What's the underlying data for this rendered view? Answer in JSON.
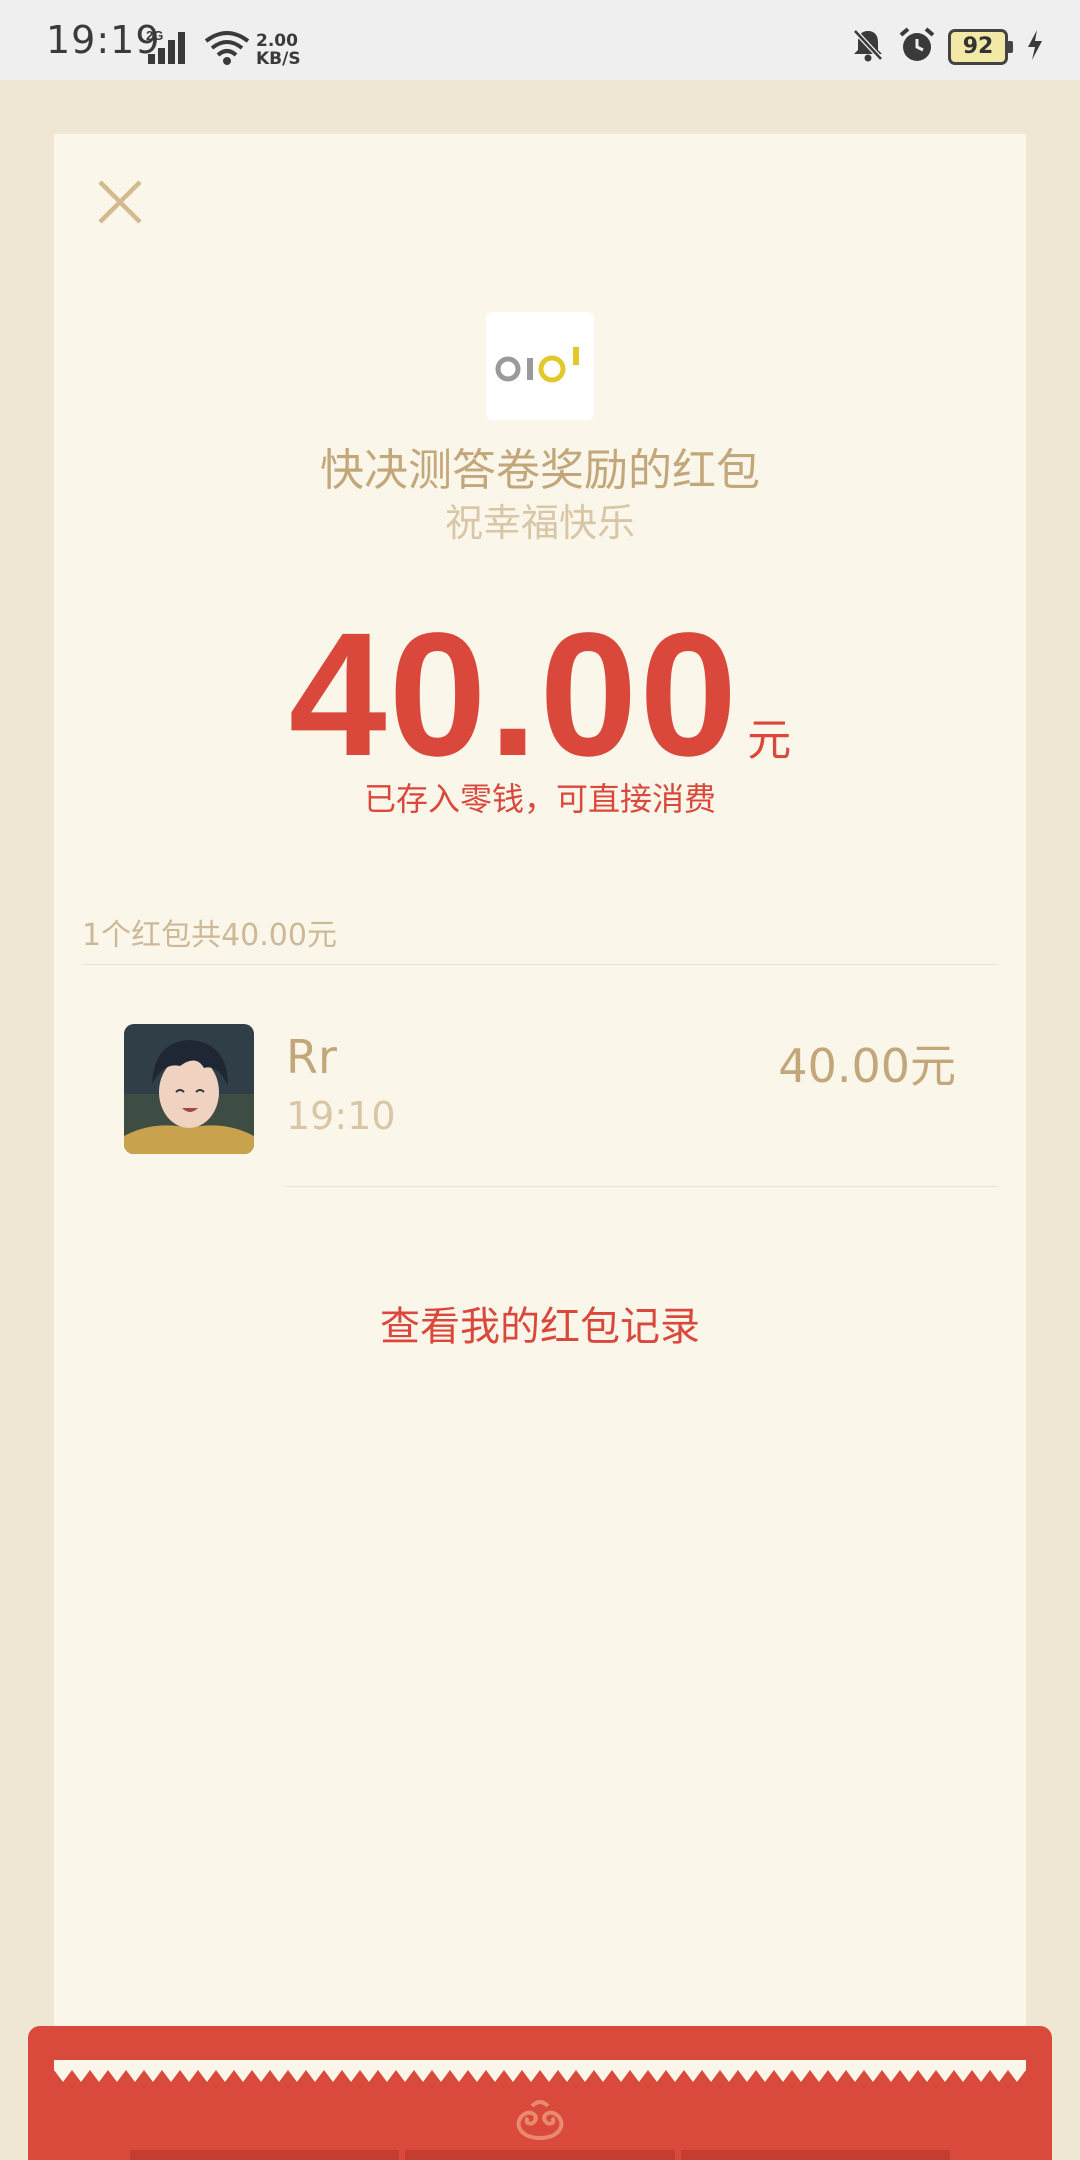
{
  "status_bar": {
    "time": "19:19",
    "network_type": "2G",
    "speed_value": "2.00",
    "speed_unit": "KB/S",
    "battery": "92"
  },
  "card": {
    "title": "快决测答卷奖励的红包",
    "greeting": "祝幸福快乐",
    "amount": "40.00",
    "amount_unit": "元",
    "deposit_note": "已存入零钱，可直接消费",
    "summary": "1个红包共40.00元",
    "records_link": "查看我的红包记录"
  },
  "recipients": [
    {
      "name": "Rr",
      "time": "19:10",
      "amount": "40.00元"
    }
  ],
  "colors": {
    "accent_red": "#d9483b",
    "gold_text": "#c2a77a",
    "card_bg": "#fbf6ea",
    "page_bg": "#efe6d3"
  }
}
